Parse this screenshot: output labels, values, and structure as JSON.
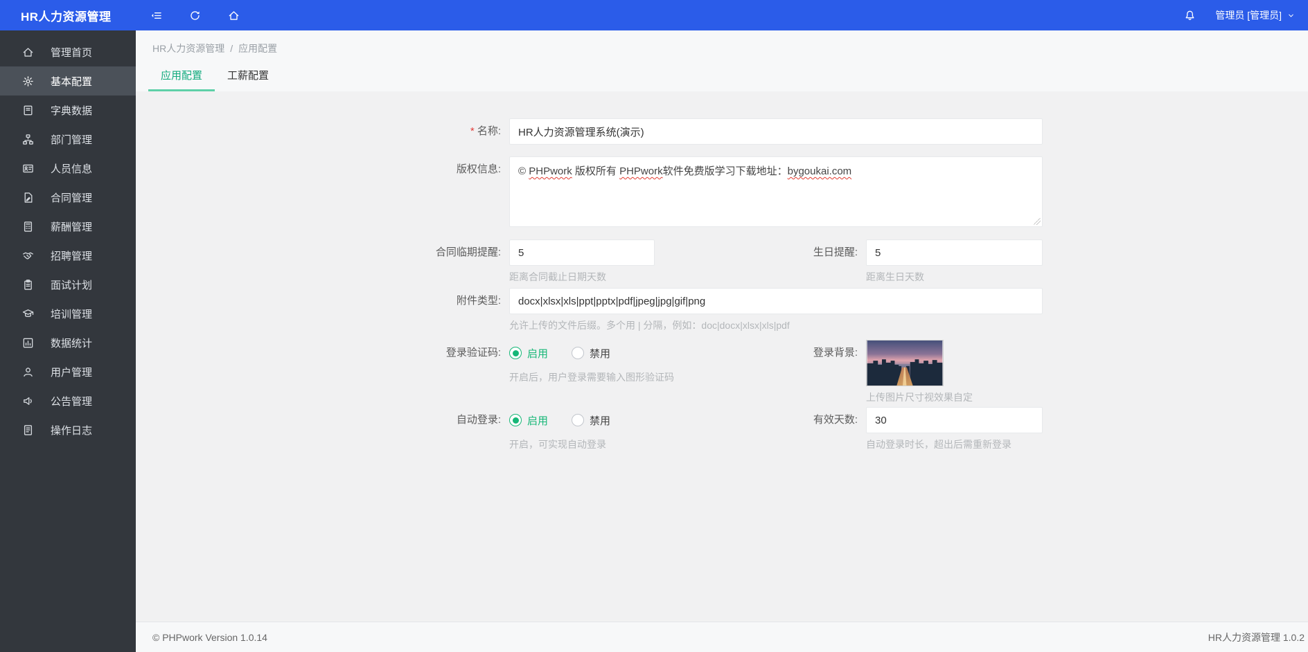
{
  "colors": {
    "header_blue": "#2b5ce9",
    "accent_green": "#16b777",
    "sidebar_dark": "#33373d",
    "tab_underline": "#5ed0a8"
  },
  "header": {
    "title": "HR人力资源管理",
    "icons": [
      "collapse-icon",
      "refresh-icon",
      "home-icon"
    ],
    "right_icons": [
      "bell-icon",
      "chevron-down-icon"
    ],
    "user": "管理员 [管理员]"
  },
  "sidebar": {
    "items": [
      {
        "label": "管理首页",
        "icon": "home-icon",
        "active": false
      },
      {
        "label": "基本配置",
        "icon": "gear-icon",
        "active": true
      },
      {
        "label": "字典数据",
        "icon": "book-icon",
        "active": false
      },
      {
        "label": "部门管理",
        "icon": "sitemap-icon",
        "active": false
      },
      {
        "label": "人员信息",
        "icon": "id-card-icon",
        "active": false
      },
      {
        "label": "合同管理",
        "icon": "file-pen-icon",
        "active": false
      },
      {
        "label": "薪酬管理",
        "icon": "calculator-icon",
        "active": false
      },
      {
        "label": "招聘管理",
        "icon": "handshake-icon",
        "active": false
      },
      {
        "label": "面试计划",
        "icon": "clipboard-icon",
        "active": false
      },
      {
        "label": "培训管理",
        "icon": "graduation-cap-icon",
        "active": false
      },
      {
        "label": "数据统计",
        "icon": "bar-chart-icon",
        "active": false
      },
      {
        "label": "用户管理",
        "icon": "user-icon",
        "active": false
      },
      {
        "label": "公告管理",
        "icon": "speaker-icon",
        "active": false
      },
      {
        "label": "操作日志",
        "icon": "log-file-icon",
        "active": false
      }
    ]
  },
  "breadcrumb": {
    "parts": [
      "HR人力资源管理",
      "应用配置"
    ],
    "separator": "/"
  },
  "tabs": [
    {
      "label": "应用配置",
      "active": true
    },
    {
      "label": "工薪配置",
      "active": false
    }
  ],
  "form": {
    "name": {
      "label": "名称:",
      "required": true,
      "value": "HR人力资源管理系统(演示)"
    },
    "copyright": {
      "label": "版权信息:",
      "value": "© PHPwork 版权所有 PHPwork软件免费版学习下载地址：bygoukai.com",
      "segments": [
        {
          "text": "© ",
          "wavy": false
        },
        {
          "text": "PHPwork",
          "wavy": true
        },
        {
          "text": " 版权所有 ",
          "wavy": false
        },
        {
          "text": "PHPwork",
          "wavy": true
        },
        {
          "text": "软件免费版学习下载地址：",
          "wavy": false
        },
        {
          "text": "bygoukai.com",
          "wavy": true
        }
      ]
    },
    "contract_remind": {
      "label": "合同临期提醒:",
      "value": "5",
      "hint": "距离合同截止日期天数"
    },
    "birthday_remind": {
      "label": "生日提醒:",
      "value": "5",
      "hint": "距离生日天数"
    },
    "attachment_types": {
      "label": "附件类型:",
      "value": "docx|xlsx|xls|ppt|pptx|pdf|jpeg|jpg|gif|png",
      "hint": "允许上传的文件后缀。多个用 | 分隔，例如：doc|docx|xlsx|xls|pdf"
    },
    "captcha": {
      "label": "登录验证码:",
      "options": [
        "启用",
        "禁用"
      ],
      "selected": "启用",
      "hint": "开启后，用户登录需要输入图形验证码"
    },
    "login_bg": {
      "label": "登录背景:",
      "image": "city-skyline-dusk-thumbnail",
      "hint": "上传图片尺寸视效果自定"
    },
    "auto_login": {
      "label": "自动登录:",
      "options": [
        "启用",
        "禁用"
      ],
      "selected": "启用",
      "hint": "开启，可实现自动登录"
    },
    "valid_days": {
      "label": "有效天数:",
      "value": "30",
      "hint": "自动登录时长，超出后需重新登录"
    }
  },
  "footer": {
    "left": "© PHPwork Version 1.0.14",
    "right": "HR人力资源管理 1.0.2"
  }
}
